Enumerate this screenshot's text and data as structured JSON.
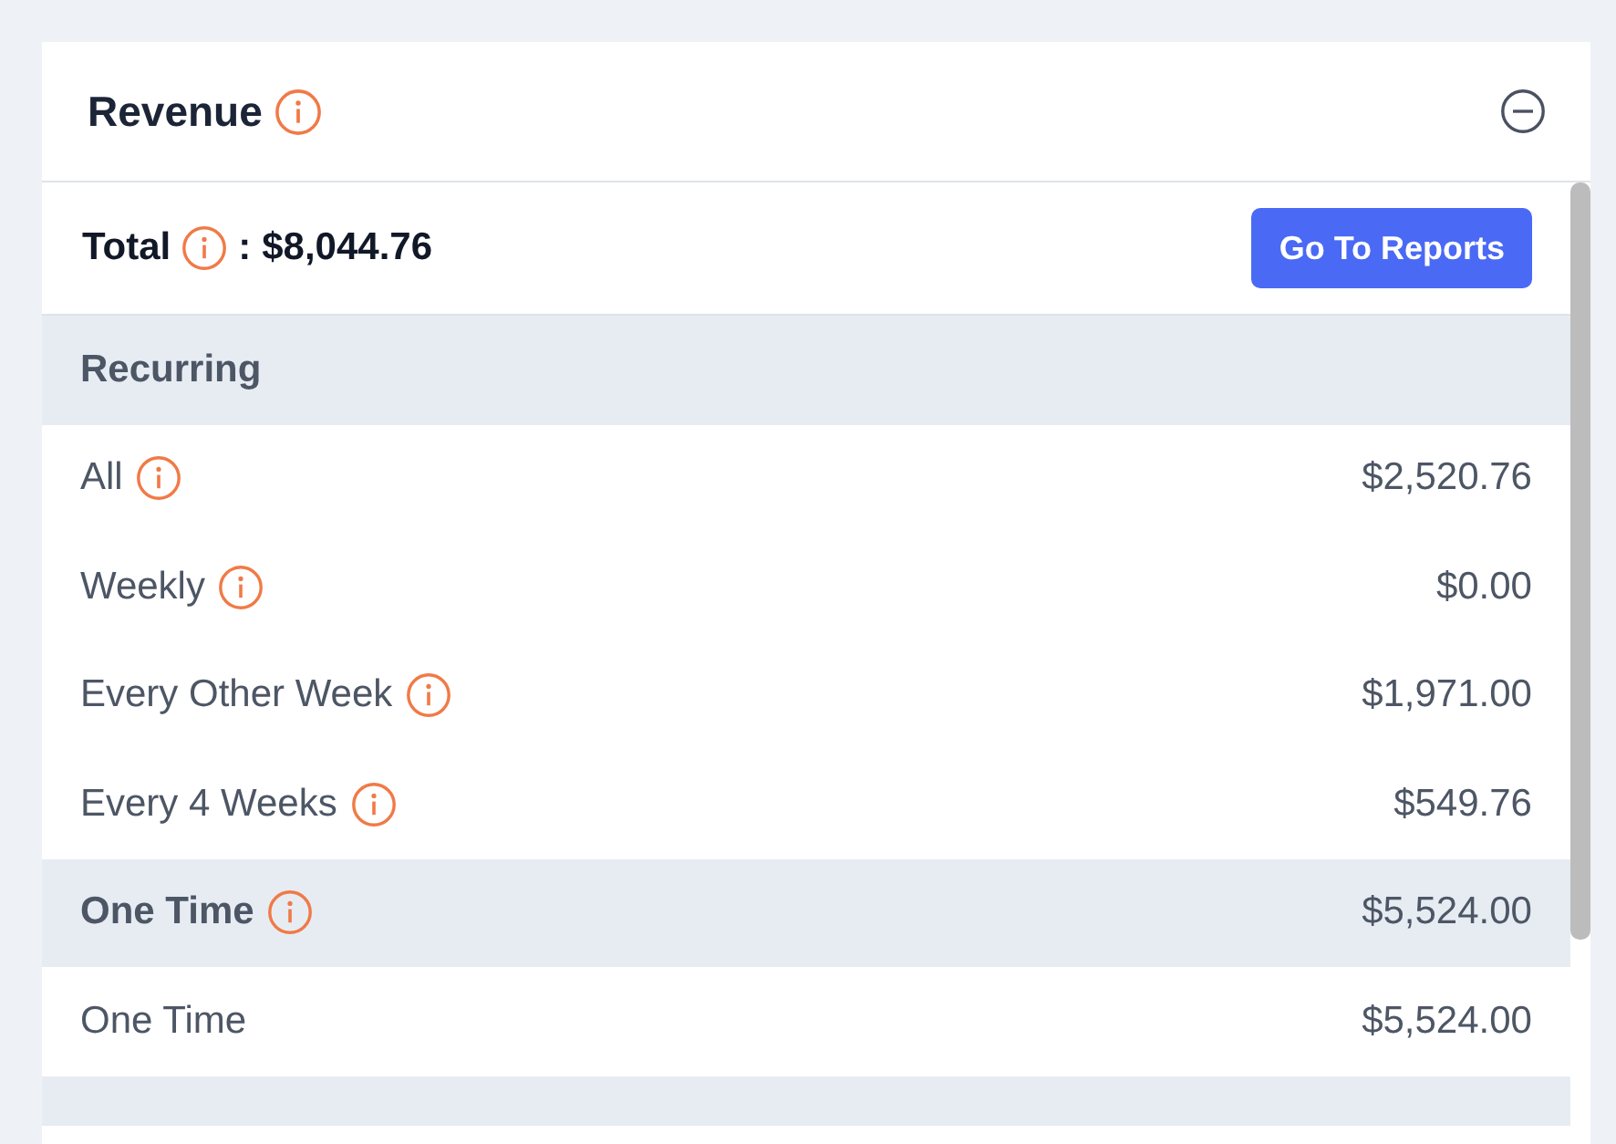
{
  "panel": {
    "title": "Revenue",
    "info": true
  },
  "total": {
    "label": "Total",
    "info": true,
    "separator": ":",
    "amount": "$8,044.76"
  },
  "reports_button": {
    "label": "Go To Reports"
  },
  "rows": [
    {
      "kind": "section",
      "label": "Recurring",
      "info": false
    },
    {
      "kind": "item",
      "label": "All",
      "info": true,
      "amount": "$2,520.76"
    },
    {
      "kind": "item",
      "label": "Weekly",
      "info": true,
      "amount": "$0.00"
    },
    {
      "kind": "item",
      "label": "Every Other Week",
      "info": true,
      "amount": "$1,971.00"
    },
    {
      "kind": "item",
      "label": "Every 4 Weeks",
      "info": true,
      "amount": "$549.76"
    },
    {
      "kind": "section",
      "label": "One Time",
      "info": true,
      "amount": "$5,524.00"
    },
    {
      "kind": "item",
      "label": "One Time",
      "info": false,
      "amount": "$5,524.00"
    },
    {
      "kind": "spacer"
    }
  ]
}
